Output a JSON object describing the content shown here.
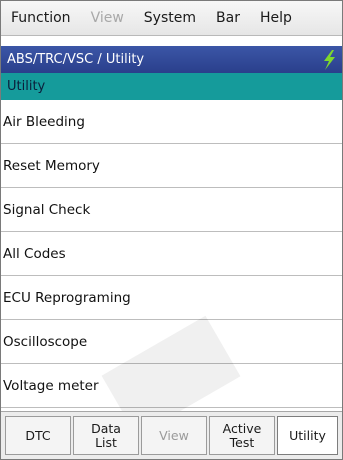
{
  "menubar": {
    "items": [
      {
        "label": "Function",
        "enabled": true
      },
      {
        "label": "View",
        "enabled": false
      },
      {
        "label": "System",
        "enabled": true
      },
      {
        "label": "Bar",
        "enabled": true
      },
      {
        "label": "Help",
        "enabled": true
      }
    ]
  },
  "header": {
    "breadcrumb": "ABS/TRC/VSC / Utility",
    "icon": "lightning-icon"
  },
  "section": {
    "title": "Utility"
  },
  "utility_list": [
    "Air Bleeding",
    "Reset Memory",
    "Signal Check",
    "All Codes",
    "ECU Reprograming",
    "Oscilloscope",
    "Voltage meter"
  ],
  "tabs": [
    {
      "label": "DTC",
      "state": "enabled"
    },
    {
      "label": "Data\nList",
      "state": "enabled"
    },
    {
      "label": "View",
      "state": "disabled"
    },
    {
      "label": "Active\nTest",
      "state": "enabled"
    },
    {
      "label": "Utility",
      "state": "selected"
    }
  ],
  "colors": {
    "title_bar": "#2f4797",
    "section_bar": "#159b9b",
    "lightning": "#7fd92c"
  }
}
